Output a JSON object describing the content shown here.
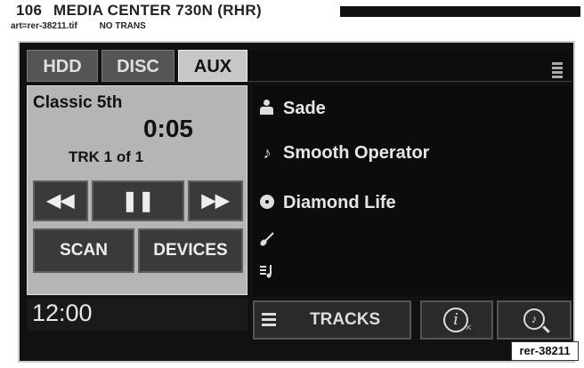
{
  "page_header": {
    "page_number": "106",
    "title": "MEDIA CENTER 730N (RHR)",
    "art_ref": "art=rer-38211.tif",
    "trans_note": "NO TRANS"
  },
  "source_tabs": [
    {
      "label": "HDD",
      "active": false
    },
    {
      "label": "DISC",
      "active": false
    },
    {
      "label": "AUX",
      "active": true
    }
  ],
  "now_playing": {
    "station": "Classic 5th",
    "elapsed": "0:05",
    "track": "TRK 1 of 1"
  },
  "controls": {
    "rewind_icon": "◀◀",
    "pause_icon": "❚❚",
    "ff_icon": "▶▶",
    "scan_label": "SCAN",
    "devices_label": "DEVICES"
  },
  "clock": "12:00",
  "track_info": {
    "artist": "Sade",
    "song": "Smooth Operator",
    "album": "Diamond Life",
    "genre": "",
    "playlist": ""
  },
  "icons": {
    "artist": "person-icon",
    "song": "music-note-icon",
    "album": "disc-icon",
    "genre": "guitar-icon",
    "playlist": "playlist-icon",
    "info": "info-icon",
    "browse": "browse-icon",
    "cabinet": "cabinet-icon"
  },
  "bottom_bar": {
    "tracks_label": "TRACKS"
  },
  "art_code": "rer-38211",
  "colors": {
    "screen_bg": "#111111",
    "active_tab": "#c7c7c7",
    "inactive_tab": "#555555",
    "panel_gray": "#b5b5b5"
  }
}
